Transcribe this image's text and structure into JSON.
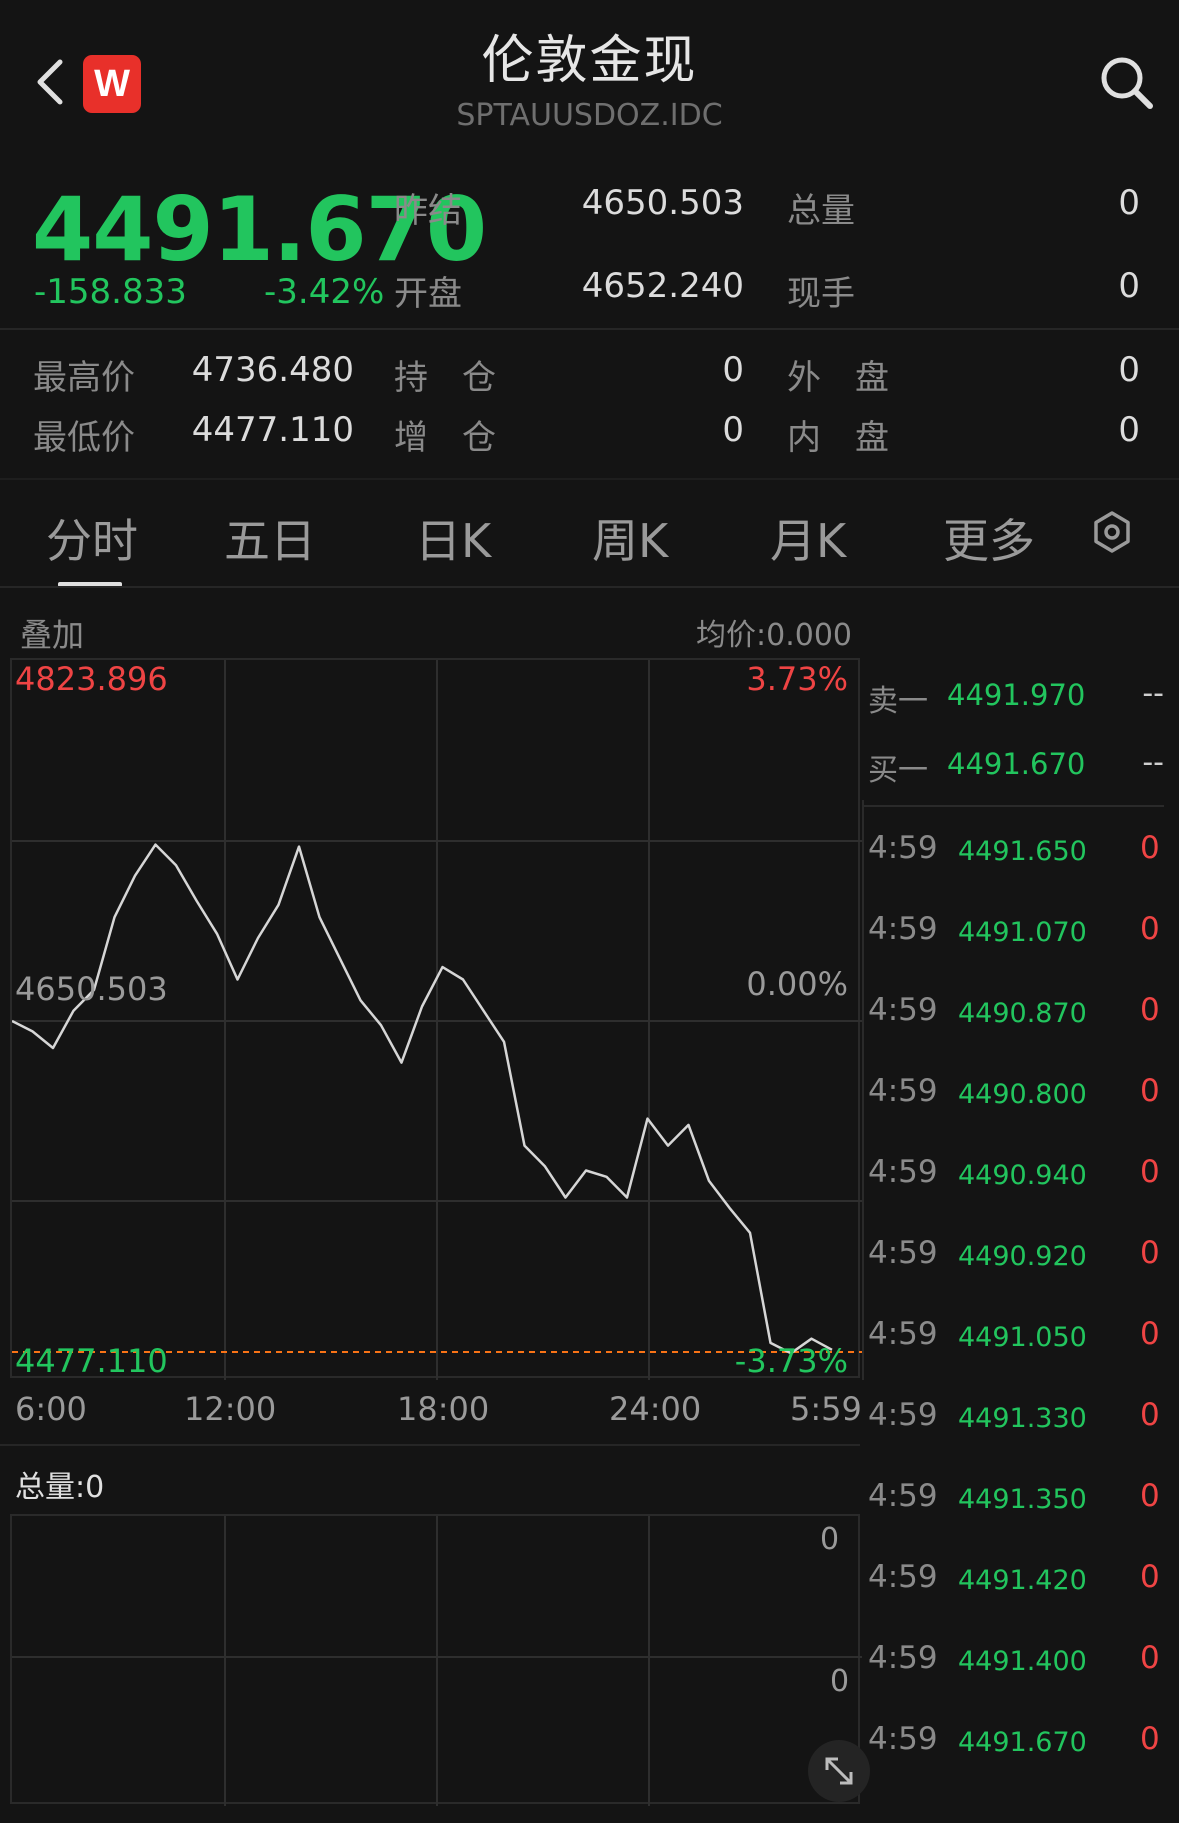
{
  "header": {
    "title": "伦敦金现",
    "code": "SPTAUUSDOZ.IDC",
    "logo_letter": "W"
  },
  "quote": {
    "price": "4491.670",
    "change": "-158.833",
    "change_pct": "-3.42%",
    "prev_settle_label": "昨结",
    "prev_settle": "4650.503",
    "open_label": "开盘",
    "open": "4652.240",
    "total_vol_label": "总量",
    "total_vol": "0",
    "cur_hand_label": "现手",
    "cur_hand": "0"
  },
  "stats": {
    "high_label": "最高价",
    "high": "4736.480",
    "low_label": "最低价",
    "low": "4477.110",
    "oi_label": "持　仓",
    "oi": "0",
    "oi_chg_label": "增　仓",
    "oi_chg": "0",
    "outer_label": "外　盘",
    "outer": "0",
    "inner_label": "内　盘",
    "inner": "0"
  },
  "tabs": [
    "分时",
    "五日",
    "日K",
    "周K",
    "月K",
    "更多"
  ],
  "active_tab": "分时",
  "chart": {
    "overlay_label": "叠加",
    "avg_label": "均价:0.000",
    "max_price": "4823.896",
    "max_pct": "3.73%",
    "mid_price": "4650.503",
    "mid_pct": "0.00%",
    "min_price": "4477.110",
    "min_pct": "-3.73%",
    "time_labels": [
      "6:00",
      "12:00",
      "18:00",
      "24:00",
      "5:59"
    ],
    "volume_label": "总量:0",
    "vol_top": "0",
    "vol_mid": "0",
    "colors": {
      "line": "#d6d6d6",
      "up": "#ef4444",
      "down": "#22c55e",
      "ref": "#f97316"
    }
  },
  "chart_data": {
    "type": "line",
    "series": [
      {
        "x": [
          "6:00",
          "6:43",
          "7:30",
          "8:30",
          "9:30",
          "10:30",
          "11:30",
          "12:00",
          "13:00",
          "14:00",
          "14:30",
          "15:30",
          "16:00",
          "16:30",
          "17:00",
          "17:30",
          "18:00",
          "18:30",
          "19:00",
          "19:30",
          "20:00",
          "20:30",
          "21:00",
          "21:30",
          "22:00",
          "22:30",
          "23:00",
          "23:30",
          "24:00",
          "0:30",
          "1:00",
          "1:30",
          "2:00",
          "2:30",
          "3:00",
          "3:30",
          "4:00",
          "4:30",
          "5:00",
          "5:30",
          "5:59"
        ],
        "values": [
          4650,
          4645,
          4637,
          4655,
          4665,
          4700,
          4720,
          4735,
          4725,
          4708,
          4692,
          4670,
          4690,
          4706,
          4734,
          4700,
          4680,
          4660,
          4648,
          4630,
          4657,
          4676,
          4670,
          4655,
          4640,
          4590,
          4580,
          4565,
          4578,
          4575,
          4565,
          4603,
          4590,
          4600,
          4573,
          4560,
          4548,
          4495,
          4490,
          4497,
          4491.67
        ]
      }
    ],
    "ylim": [
      4477.11,
      4823.896
    ],
    "reference": 4650.503
  },
  "orderbook": {
    "sell1_label": "卖一",
    "sell1_price": "4491.970",
    "sell1_vol": "--",
    "buy1_label": "买一",
    "buy1_price": "4491.670",
    "buy1_vol": "--",
    "ticks": [
      {
        "time": "4:59",
        "price": "4491.650",
        "vol": "0"
      },
      {
        "time": "4:59",
        "price": "4491.070",
        "vol": "0"
      },
      {
        "time": "4:59",
        "price": "4490.870",
        "vol": "0"
      },
      {
        "time": "4:59",
        "price": "4490.800",
        "vol": "0"
      },
      {
        "time": "4:59",
        "price": "4490.940",
        "vol": "0"
      },
      {
        "time": "4:59",
        "price": "4490.920",
        "vol": "0"
      },
      {
        "time": "4:59",
        "price": "4491.050",
        "vol": "0"
      },
      {
        "time": "4:59",
        "price": "4491.330",
        "vol": "0"
      },
      {
        "time": "4:59",
        "price": "4491.350",
        "vol": "0"
      },
      {
        "time": "4:59",
        "price": "4491.420",
        "vol": "0"
      },
      {
        "time": "4:59",
        "price": "4491.400",
        "vol": "0"
      },
      {
        "time": "4:59",
        "price": "4491.670",
        "vol": "0"
      }
    ]
  }
}
